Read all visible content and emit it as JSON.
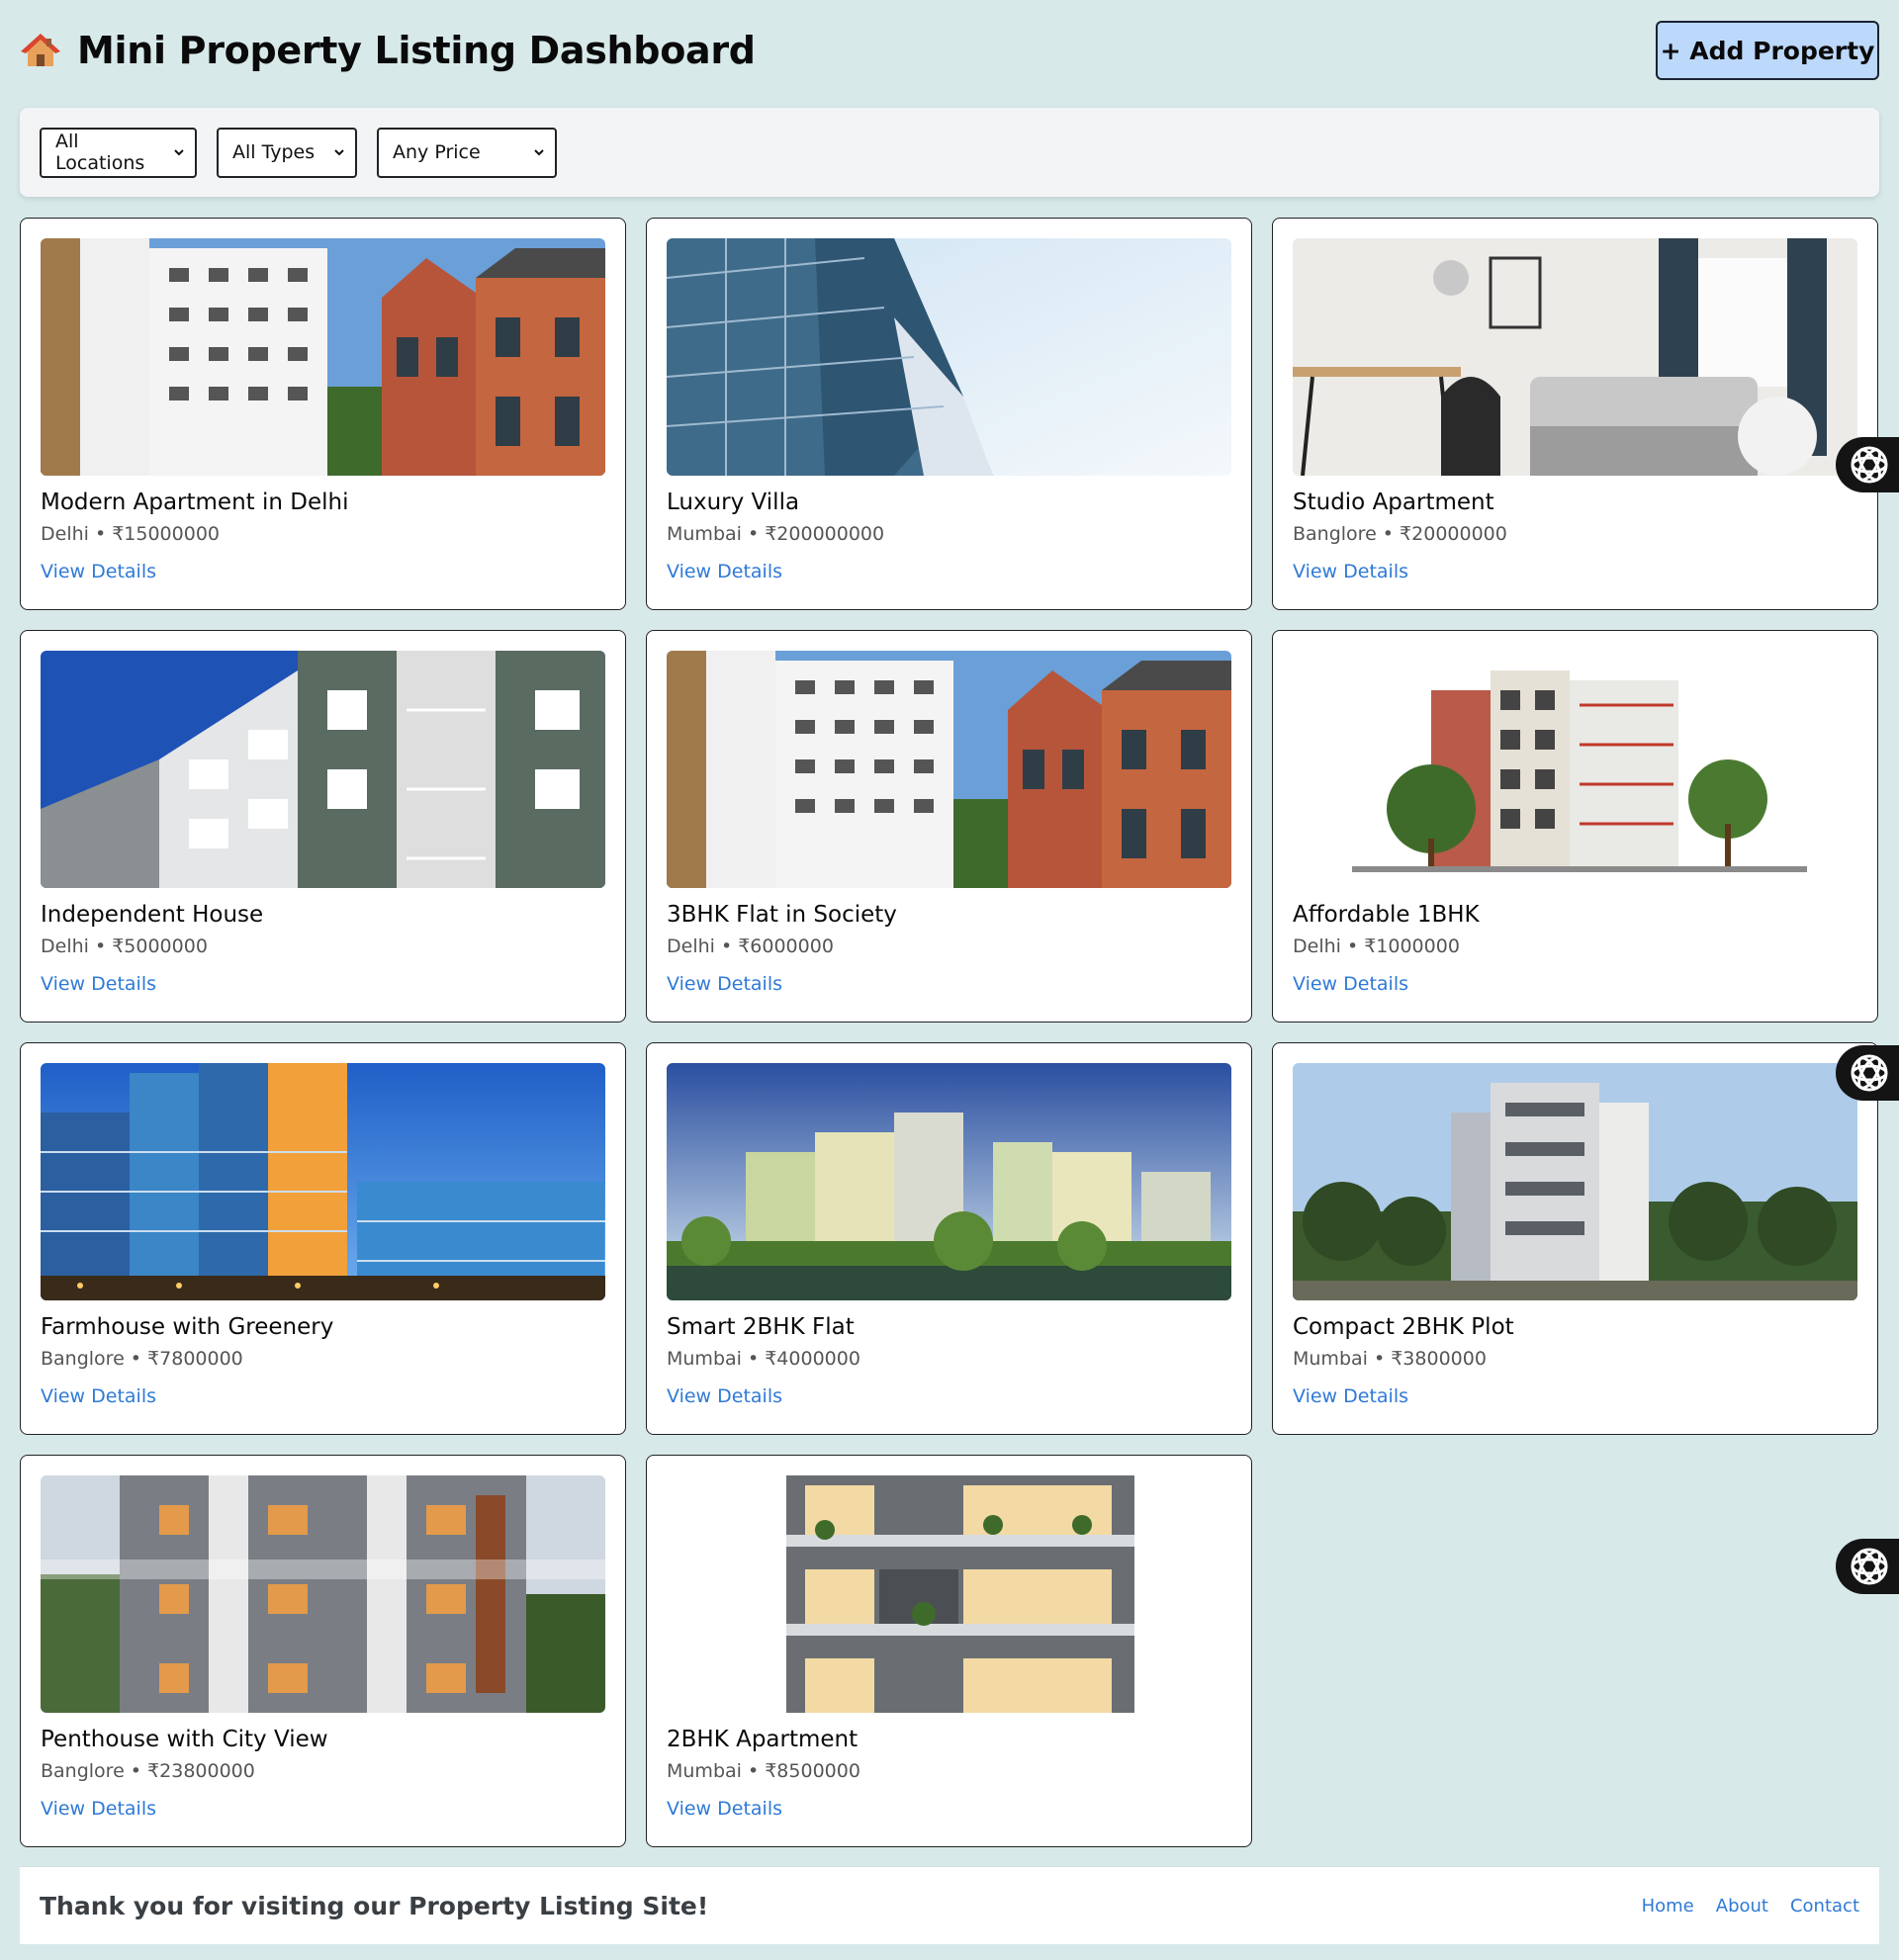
{
  "header": {
    "title": "Mini Property Listing Dashboard",
    "add_button": "+ Add Property"
  },
  "filters": {
    "location": "All Locations",
    "type": "All Types",
    "price": "Any Price"
  },
  "listings": [
    {
      "title": "Modern Apartment in Delhi",
      "meta": "Delhi • ₹15000000",
      "link": "View Details"
    },
    {
      "title": "Luxury Villa",
      "meta": "Mumbai • ₹200000000",
      "link": "View Details"
    },
    {
      "title": "Studio Apartment",
      "meta": "Banglore • ₹20000000",
      "link": "View Details"
    },
    {
      "title": "Independent House",
      "meta": "Delhi • ₹5000000",
      "link": "View Details"
    },
    {
      "title": "3BHK Flat in Society",
      "meta": "Delhi • ₹6000000",
      "link": "View Details"
    },
    {
      "title": "Affordable 1BHK",
      "meta": "Delhi • ₹1000000",
      "link": "View Details"
    },
    {
      "title": "Farmhouse with Greenery",
      "meta": "Banglore • ₹7800000",
      "link": "View Details"
    },
    {
      "title": "Smart 2BHK Flat",
      "meta": "Mumbai • ₹4000000",
      "link": "View Details"
    },
    {
      "title": "Compact 2BHK Plot",
      "meta": "Mumbai • ₹3800000",
      "link": "View Details"
    },
    {
      "title": "Penthouse with City View",
      "meta": "Banglore • ₹23800000",
      "link": "View Details"
    },
    {
      "title": "2BHK Apartment",
      "meta": "Mumbai • ₹8500000",
      "link": "View Details"
    }
  ],
  "footer": {
    "thanks": "Thank you for visiting our Property Listing Site!",
    "nav": [
      "Home",
      "About",
      "Contact"
    ]
  }
}
